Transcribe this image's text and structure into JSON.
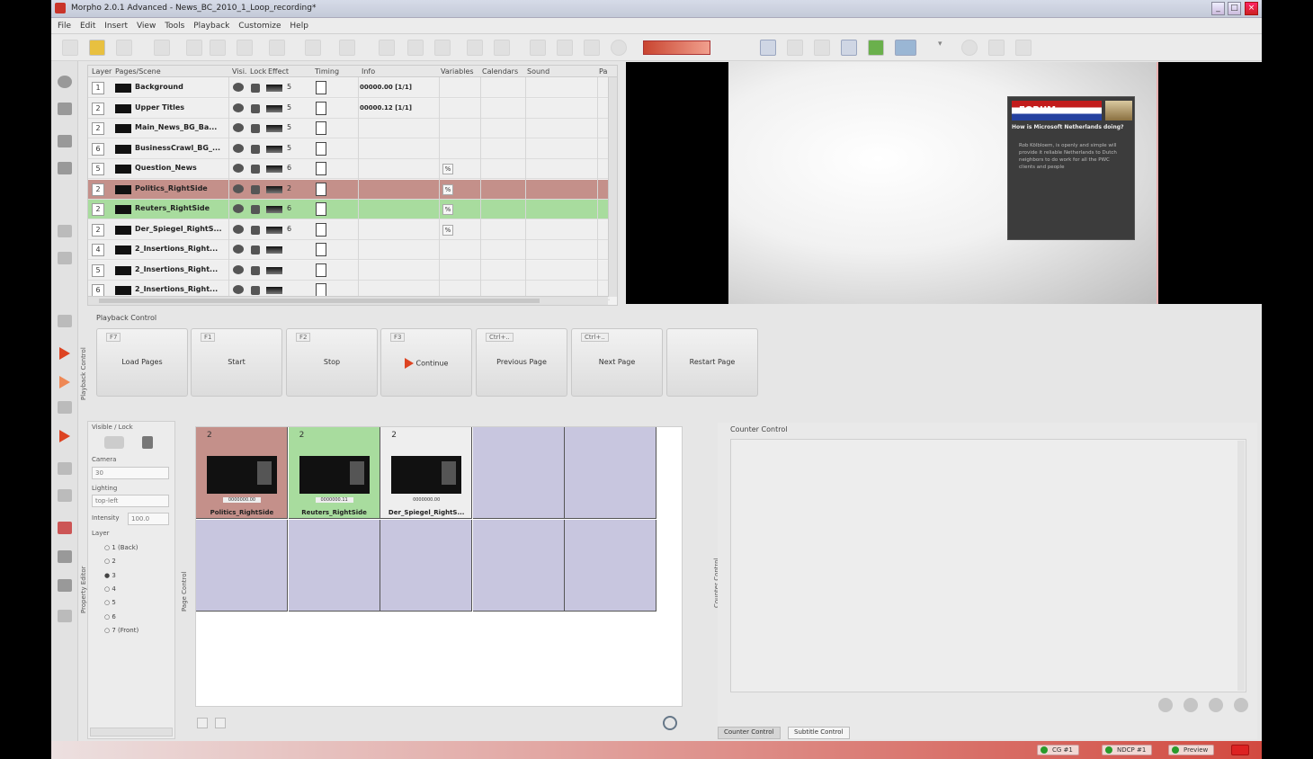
{
  "window": {
    "title": "Morpho 2.0.1 Advanced - News_BC_2010_1_Loop_recording*"
  },
  "menu": [
    "File",
    "Edit",
    "Insert",
    "View",
    "Tools",
    "Playback",
    "Customize",
    "Help"
  ],
  "layers": {
    "headers": [
      "Layer",
      "Pages/Scene",
      "Visi.",
      "Lock",
      "Effect",
      "Timing",
      "Info",
      "Variables",
      "Calendars",
      "Sound",
      "Pa"
    ],
    "rows": [
      {
        "num": "1",
        "name": "Background",
        "effect": "5",
        "info": "00000.00 [1/1]",
        "style": "normal",
        "var": ""
      },
      {
        "num": "2",
        "name": "Upper Titles",
        "effect": "5",
        "info": "00000.12 [1/1]",
        "style": "normal",
        "var": ""
      },
      {
        "num": "2",
        "name": "Main_News_BG_Ba...",
        "effect": "5",
        "info": "",
        "style": "normal",
        "var": ""
      },
      {
        "num": "6",
        "name": "BusinessCrawl_BG_...",
        "effect": "5",
        "info": "",
        "style": "normal",
        "var": ""
      },
      {
        "num": "5",
        "name": "Question_News",
        "effect": "6",
        "info": "",
        "style": "normal",
        "var": "%"
      },
      {
        "num": "2",
        "name": "Politics_RightSide",
        "effect": "2",
        "info": "",
        "style": "red",
        "var": "%"
      },
      {
        "num": "2",
        "name": "Reuters_RightSide",
        "effect": "6",
        "info": "",
        "style": "green",
        "var": "%"
      },
      {
        "num": "2",
        "name": "Der_Spiegel_RightS...",
        "effect": "6",
        "info": "",
        "style": "normal",
        "var": "%"
      },
      {
        "num": "4",
        "name": "2_Insertions_Right...",
        "effect": "",
        "info": "",
        "style": "normal",
        "var": ""
      },
      {
        "num": "5",
        "name": "2_Insertions_Right...",
        "effect": "",
        "info": "",
        "style": "normal",
        "var": ""
      },
      {
        "num": "6",
        "name": "2_Insertions_Right...",
        "effect": "",
        "info": "",
        "style": "normal",
        "var": ""
      }
    ]
  },
  "preview": {
    "flag_text": "FORUM",
    "question": "How is Microsoft Netherlands doing?",
    "body": "Rob Kölbloem, is openly and simple will provide it reliable Netherlands to Dutch neighbors to do work for all the PWC clients and people"
  },
  "playback": {
    "title": "Playback Control",
    "side_label": "Playback Control",
    "buttons": [
      {
        "key": "F7",
        "label": "Load Pages"
      },
      {
        "key": "F1",
        "label": "Start"
      },
      {
        "key": "F2",
        "label": "Stop"
      },
      {
        "key": "F3",
        "label": "Continue"
      },
      {
        "key": "Ctrl+..",
        "label": "Previous Page"
      },
      {
        "key": "Ctrl+..",
        "label": "Next Page"
      },
      {
        "key": "",
        "label": "Restart Page"
      }
    ]
  },
  "properties": {
    "caption": "Visible / Lock",
    "camera_label": "Camera",
    "camera_value": "30",
    "lighting_label": "Lighting",
    "lighting_value": "top-left",
    "intensity_label": "Intensity",
    "intensity_value": "100.0",
    "layer_label": "Layer",
    "layers": [
      "1 (Back)",
      "2",
      "3",
      "4",
      "5",
      "6",
      "7 (Front)"
    ],
    "side_label": "Property Editor"
  },
  "pages": {
    "side_label": "Page Control",
    "cells": [
      {
        "name": "Politics_RightSide",
        "sub": "0000000.00",
        "style": "red",
        "num": "2"
      },
      {
        "name": "Reuters_RightSide",
        "sub": "0000000.11",
        "style": "green",
        "num": "2"
      },
      {
        "name": "Der_Spiegel_RightS...",
        "sub": "0000000.00",
        "style": "white",
        "num": "2"
      }
    ]
  },
  "counter": {
    "title": "Counter Control",
    "side_label": "Counter Control",
    "tabs": [
      "Counter Control",
      "Subtitle Control"
    ]
  },
  "status": [
    {
      "label": "CG #1"
    },
    {
      "label": "NDCP #1"
    },
    {
      "label": "Preview"
    }
  ],
  "colors": {
    "accent_red": "#c4908a",
    "accent_green": "#a8dc9e",
    "play_red": "#dd4422"
  }
}
